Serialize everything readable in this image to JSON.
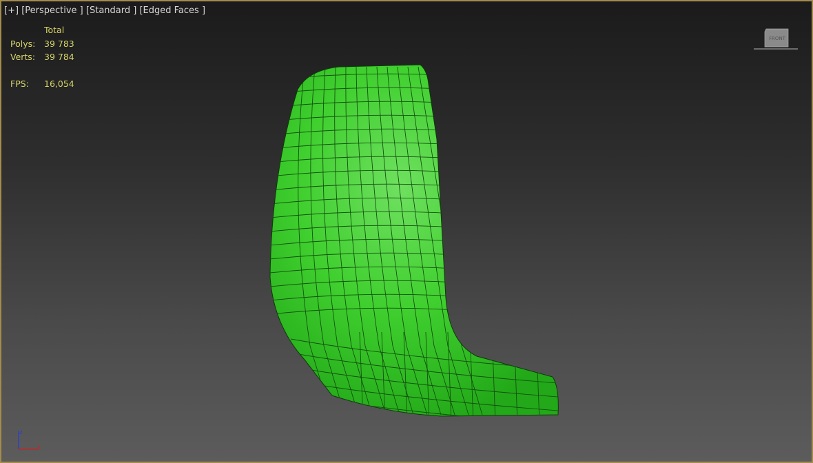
{
  "viewport": {
    "label_items": [
      "[+]",
      "[Perspective ]",
      "[Standard ]",
      "[Edged Faces ]"
    ],
    "stats": {
      "column_header": "Total",
      "polys_label": "Polys:",
      "polys_value": "39 783",
      "verts_label": "Verts:",
      "verts_value": "39 784",
      "fps_label": "FPS:",
      "fps_value": "16,054"
    },
    "viewcube_face": "FRONT",
    "axis_labels": {
      "z": "z",
      "x": "x"
    },
    "colors": {
      "border": "#a48c4c",
      "model": "#33cc22",
      "stats_text": "#d6d46a"
    }
  }
}
